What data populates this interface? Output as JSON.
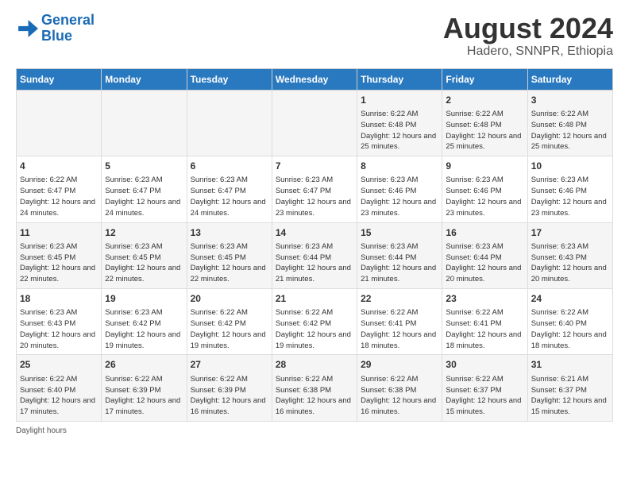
{
  "logo": {
    "line1": "General",
    "line2": "Blue"
  },
  "title": "August 2024",
  "subtitle": "Hadero, SNNPR, Ethiopia",
  "days_of_week": [
    "Sunday",
    "Monday",
    "Tuesday",
    "Wednesday",
    "Thursday",
    "Friday",
    "Saturday"
  ],
  "footer_label": "Daylight hours",
  "weeks": [
    [
      {
        "num": "",
        "sunrise": "",
        "sunset": "",
        "daylight": ""
      },
      {
        "num": "",
        "sunrise": "",
        "sunset": "",
        "daylight": ""
      },
      {
        "num": "",
        "sunrise": "",
        "sunset": "",
        "daylight": ""
      },
      {
        "num": "",
        "sunrise": "",
        "sunset": "",
        "daylight": ""
      },
      {
        "num": "1",
        "sunrise": "Sunrise: 6:22 AM",
        "sunset": "Sunset: 6:48 PM",
        "daylight": "Daylight: 12 hours and 25 minutes."
      },
      {
        "num": "2",
        "sunrise": "Sunrise: 6:22 AM",
        "sunset": "Sunset: 6:48 PM",
        "daylight": "Daylight: 12 hours and 25 minutes."
      },
      {
        "num": "3",
        "sunrise": "Sunrise: 6:22 AM",
        "sunset": "Sunset: 6:48 PM",
        "daylight": "Daylight: 12 hours and 25 minutes."
      }
    ],
    [
      {
        "num": "4",
        "sunrise": "Sunrise: 6:22 AM",
        "sunset": "Sunset: 6:47 PM",
        "daylight": "Daylight: 12 hours and 24 minutes."
      },
      {
        "num": "5",
        "sunrise": "Sunrise: 6:23 AM",
        "sunset": "Sunset: 6:47 PM",
        "daylight": "Daylight: 12 hours and 24 minutes."
      },
      {
        "num": "6",
        "sunrise": "Sunrise: 6:23 AM",
        "sunset": "Sunset: 6:47 PM",
        "daylight": "Daylight: 12 hours and 24 minutes."
      },
      {
        "num": "7",
        "sunrise": "Sunrise: 6:23 AM",
        "sunset": "Sunset: 6:47 PM",
        "daylight": "Daylight: 12 hours and 23 minutes."
      },
      {
        "num": "8",
        "sunrise": "Sunrise: 6:23 AM",
        "sunset": "Sunset: 6:46 PM",
        "daylight": "Daylight: 12 hours and 23 minutes."
      },
      {
        "num": "9",
        "sunrise": "Sunrise: 6:23 AM",
        "sunset": "Sunset: 6:46 PM",
        "daylight": "Daylight: 12 hours and 23 minutes."
      },
      {
        "num": "10",
        "sunrise": "Sunrise: 6:23 AM",
        "sunset": "Sunset: 6:46 PM",
        "daylight": "Daylight: 12 hours and 23 minutes."
      }
    ],
    [
      {
        "num": "11",
        "sunrise": "Sunrise: 6:23 AM",
        "sunset": "Sunset: 6:45 PM",
        "daylight": "Daylight: 12 hours and 22 minutes."
      },
      {
        "num": "12",
        "sunrise": "Sunrise: 6:23 AM",
        "sunset": "Sunset: 6:45 PM",
        "daylight": "Daylight: 12 hours and 22 minutes."
      },
      {
        "num": "13",
        "sunrise": "Sunrise: 6:23 AM",
        "sunset": "Sunset: 6:45 PM",
        "daylight": "Daylight: 12 hours and 22 minutes."
      },
      {
        "num": "14",
        "sunrise": "Sunrise: 6:23 AM",
        "sunset": "Sunset: 6:44 PM",
        "daylight": "Daylight: 12 hours and 21 minutes."
      },
      {
        "num": "15",
        "sunrise": "Sunrise: 6:23 AM",
        "sunset": "Sunset: 6:44 PM",
        "daylight": "Daylight: 12 hours and 21 minutes."
      },
      {
        "num": "16",
        "sunrise": "Sunrise: 6:23 AM",
        "sunset": "Sunset: 6:44 PM",
        "daylight": "Daylight: 12 hours and 20 minutes."
      },
      {
        "num": "17",
        "sunrise": "Sunrise: 6:23 AM",
        "sunset": "Sunset: 6:43 PM",
        "daylight": "Daylight: 12 hours and 20 minutes."
      }
    ],
    [
      {
        "num": "18",
        "sunrise": "Sunrise: 6:23 AM",
        "sunset": "Sunset: 6:43 PM",
        "daylight": "Daylight: 12 hours and 20 minutes."
      },
      {
        "num": "19",
        "sunrise": "Sunrise: 6:23 AM",
        "sunset": "Sunset: 6:42 PM",
        "daylight": "Daylight: 12 hours and 19 minutes."
      },
      {
        "num": "20",
        "sunrise": "Sunrise: 6:22 AM",
        "sunset": "Sunset: 6:42 PM",
        "daylight": "Daylight: 12 hours and 19 minutes."
      },
      {
        "num": "21",
        "sunrise": "Sunrise: 6:22 AM",
        "sunset": "Sunset: 6:42 PM",
        "daylight": "Daylight: 12 hours and 19 minutes."
      },
      {
        "num": "22",
        "sunrise": "Sunrise: 6:22 AM",
        "sunset": "Sunset: 6:41 PM",
        "daylight": "Daylight: 12 hours and 18 minutes."
      },
      {
        "num": "23",
        "sunrise": "Sunrise: 6:22 AM",
        "sunset": "Sunset: 6:41 PM",
        "daylight": "Daylight: 12 hours and 18 minutes."
      },
      {
        "num": "24",
        "sunrise": "Sunrise: 6:22 AM",
        "sunset": "Sunset: 6:40 PM",
        "daylight": "Daylight: 12 hours and 18 minutes."
      }
    ],
    [
      {
        "num": "25",
        "sunrise": "Sunrise: 6:22 AM",
        "sunset": "Sunset: 6:40 PM",
        "daylight": "Daylight: 12 hours and 17 minutes."
      },
      {
        "num": "26",
        "sunrise": "Sunrise: 6:22 AM",
        "sunset": "Sunset: 6:39 PM",
        "daylight": "Daylight: 12 hours and 17 minutes."
      },
      {
        "num": "27",
        "sunrise": "Sunrise: 6:22 AM",
        "sunset": "Sunset: 6:39 PM",
        "daylight": "Daylight: 12 hours and 16 minutes."
      },
      {
        "num": "28",
        "sunrise": "Sunrise: 6:22 AM",
        "sunset": "Sunset: 6:38 PM",
        "daylight": "Daylight: 12 hours and 16 minutes."
      },
      {
        "num": "29",
        "sunrise": "Sunrise: 6:22 AM",
        "sunset": "Sunset: 6:38 PM",
        "daylight": "Daylight: 12 hours and 16 minutes."
      },
      {
        "num": "30",
        "sunrise": "Sunrise: 6:22 AM",
        "sunset": "Sunset: 6:37 PM",
        "daylight": "Daylight: 12 hours and 15 minutes."
      },
      {
        "num": "31",
        "sunrise": "Sunrise: 6:21 AM",
        "sunset": "Sunset: 6:37 PM",
        "daylight": "Daylight: 12 hours and 15 minutes."
      }
    ]
  ]
}
